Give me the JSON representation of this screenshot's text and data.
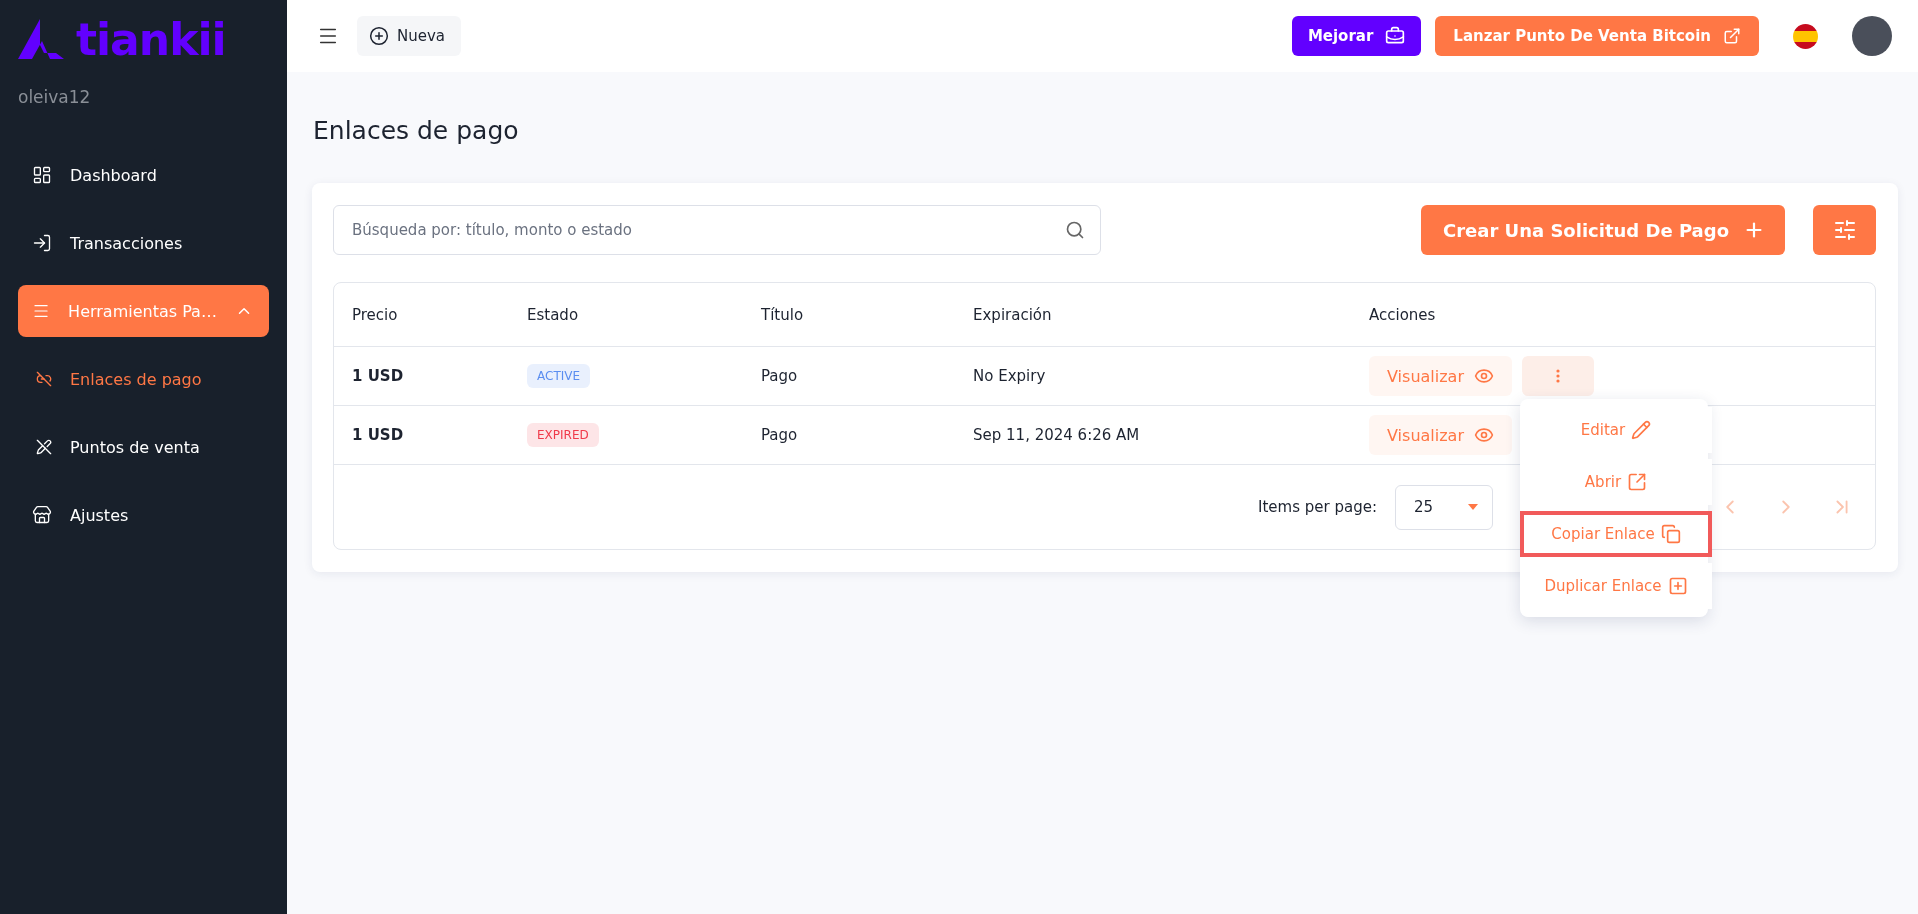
{
  "brand": {
    "name": "tiankii"
  },
  "user": {
    "username": "oleiva12"
  },
  "sidebar": {
    "items": [
      {
        "label": "Dashboard",
        "selected": false
      },
      {
        "label": "Transacciones",
        "selected": false
      },
      {
        "label": "Herramientas Pa…",
        "selected": true,
        "expanded": true,
        "children": [
          {
            "label": "Enlaces de pago",
            "selected": true
          },
          {
            "label": "Puntos de venta",
            "selected": false
          }
        ]
      },
      {
        "label": "Ajustes",
        "selected": false
      }
    ]
  },
  "topbar": {
    "new_button": "Nueva",
    "upgrade_button": "Mejorar",
    "launch_button": "Lanzar Punto De Venta Bitcoin"
  },
  "page_title": "Enlaces de pago",
  "search": {
    "placeholder": "Búsqueda por: título, monto o estado"
  },
  "create_button": "Crear Una Solicitud De Pago",
  "table": {
    "columns": [
      "Precio",
      "Estado",
      "Título",
      "Expiración",
      "Acciones"
    ],
    "rows": [
      {
        "price": "1 USD",
        "status": "ACTIVE",
        "color": "#5b8ef0",
        "title": "Pago",
        "expiry": "No Expiry",
        "view_button": "Visualizar",
        "menu_open": true
      },
      {
        "price": "1 USD",
        "status": "EXPIRED",
        "color": "#f03a4a",
        "title": "Pago",
        "expiry": "Sep 11, 2024 6:26 AM",
        "view_button": "Visualizar",
        "menu_open": false
      }
    ]
  },
  "row_menu": {
    "items": [
      {
        "label": "Editar",
        "selected": false
      },
      {
        "label": "Abrir",
        "selected": false
      },
      {
        "label": "Copiar Enlace",
        "selected": true
      },
      {
        "label": "Duplicar Enlace",
        "selected": false
      }
    ]
  },
  "pagination": {
    "label": "Items per page:",
    "per_page": "25",
    "prev_disabled": true,
    "next_disabled": true,
    "last_disabled": true
  }
}
